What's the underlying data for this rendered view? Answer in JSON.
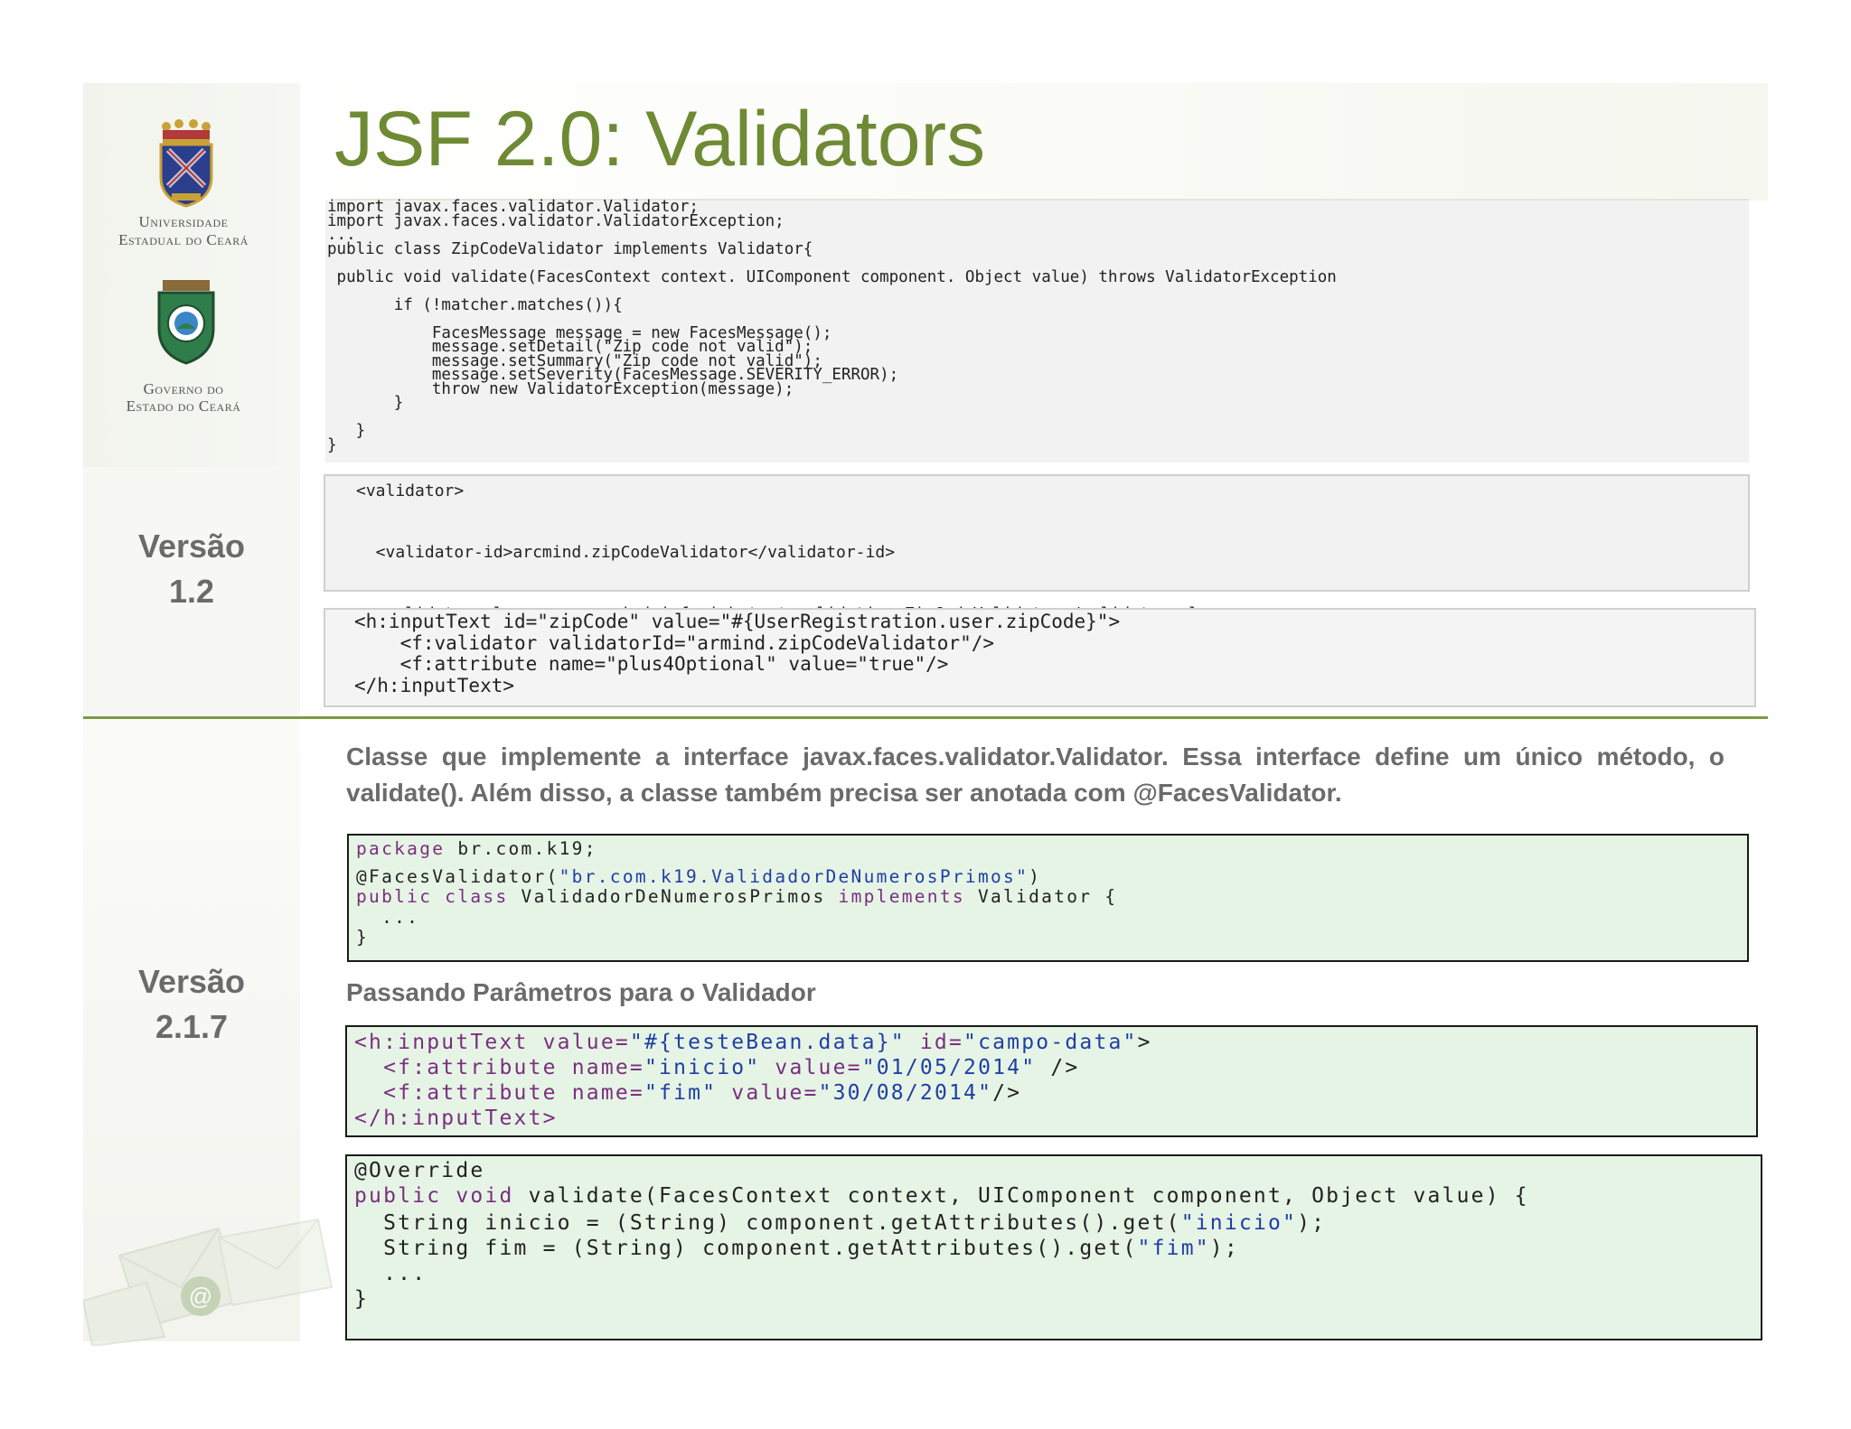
{
  "slide": {
    "title": "JSF 2.0: Validators"
  },
  "logos": {
    "university_line1": "Universidade",
    "university_line2": "Estadual do Ceará",
    "government_line1": "Governo do",
    "government_line2": "Estado do Ceará"
  },
  "version_12": {
    "label": "Versão",
    "number": "1.2",
    "java_code": "import javax.faces.validator.Validator;\nimport javax.faces.validator.ValidatorException;\n...\npublic class ZipCodeValidator implements Validator{\n\n public void validate(FacesContext context. UIComponent component. Object value) throws ValidatorException\n\n       if (!matcher.matches()){\n\n           FacesMessage message = new FacesMessage();\n           message.setDetail(\"Zip code not valid\");\n           message.setSummary(\"Zip code not valid\");\n           message.setSeverity(FacesMessage.SEVERITY_ERROR);\n           throw new ValidatorException(message);\n       }\n\n   }\n}",
    "xml_code": "<validator>\n\n  <validator-id>arcmind.zipCodeValidator</validator-id>\n\n  <validator-class>com.arcmind.jsfquickstart.validation.ZipCodeValidator</validator-class>\n\n</validator>",
    "input_code": "<h:inputText id=\"zipCode\" value=\"#{UserRegistration.user.zipCode}\">\n    <f:validator validatorId=\"armind.zipCodeValidator\"/>\n    <f:attribute name=\"plus4Optional\" value=\"true\"/>\n</h:inputText>"
  },
  "version_217": {
    "label": "Versão",
    "number": "2.1.7",
    "description": "Classe que implemente a interface javax.faces.validator.Validator. Essa interface define um único método, o validate(). Além disso, a classe também precisa ser anotada com @FacesValidator.",
    "subheading": "Passando Parâmetros para o Validador",
    "code_a": {
      "l1_kw": "package",
      "l1_rest": " br.com.k19;",
      "l2_ann": "@FacesValidator(",
      "l2_str": "\"br.com.k19.ValidadorDeNumerosPrimos\"",
      "l2_end": ")",
      "l3_kw1": "public class",
      "l3_mid": " ValidadorDeNumerosPrimos ",
      "l3_kw2": "implements",
      "l3_end": " Validator {",
      "l4": "  ...",
      "l5": "}"
    },
    "code_b": {
      "l1_tag": "<h:inputText",
      "l1_a1": " value=",
      "l1_v1": "\"#{testeBean.data}\"",
      "l1_a2": " id=",
      "l1_v2": "\"campo-data\"",
      "l1_end": ">",
      "l2_tag": "  <f:attribute",
      "l2_a1": " name=",
      "l2_v1": "\"inicio\"",
      "l2_a2": " value=",
      "l2_v2": "\"01/05/2014\"",
      "l2_end": " />",
      "l3_tag": "  <f:attribute",
      "l3_a1": " name=",
      "l3_v1": "\"fim\"",
      "l3_a2": " value=",
      "l3_v2": "\"30/08/2014\"",
      "l3_end": "/>",
      "l4_tag": "</h:inputText>"
    },
    "code_c": {
      "l1": "@Override",
      "l2_kw": "public void",
      "l2_rest": " validate(FacesContext context, UIComponent component, Object value) {",
      "l4_a": "  String inicio = (String) component.getAttributes().get(",
      "l4_str": "\"inicio\"",
      "l4_end": ");",
      "l5_a": "  String fim = (String) component.getAttributes().get(",
      "l5_str": "\"fim\"",
      "l5_end": ");",
      "l6": "  ...",
      "l7": "}"
    }
  },
  "colors": {
    "title_green": "#6f8a34",
    "divider_green": "#7c9a45",
    "code_box_green": "#e6f4e6",
    "keyword_purple": "#7a2e7f",
    "string_blue": "#1f3fa3"
  }
}
